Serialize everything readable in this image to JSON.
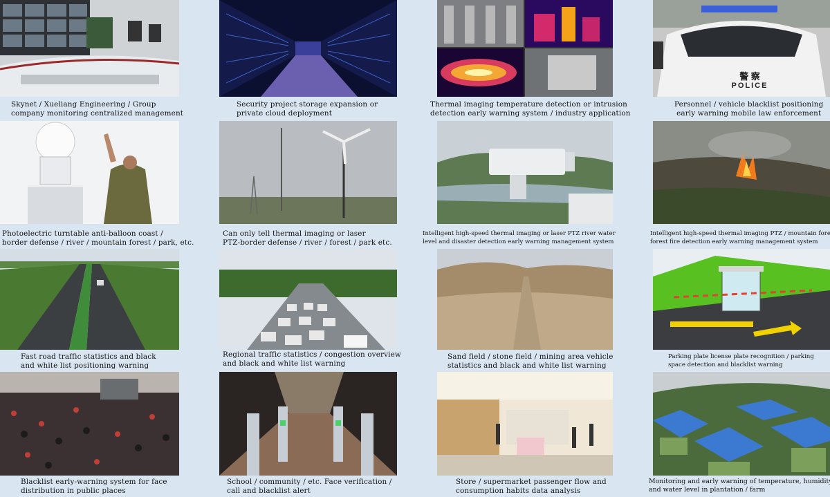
{
  "tiles": [
    {
      "name": "monitoring-center",
      "lines": [
        "Skynet / Xueliang Engineering / Group",
        "company monitoring centralized management"
      ]
    },
    {
      "name": "storage-datacenter",
      "lines": [
        "Security project storage expansion or",
        "private cloud deployment"
      ]
    },
    {
      "name": "thermal-imaging",
      "lines": [
        "Thermal imaging temperature detection or intrusion",
        "detection early warning system / industry application"
      ]
    },
    {
      "name": "police-vehicle",
      "lines": [
        "Personnel / vehicle blacklist positioning",
        "early warning mobile law enforcement"
      ],
      "badge": "POLICE",
      "badge_cn": "警 察"
    },
    {
      "name": "anti-balloon-turntable",
      "lines": [
        "Photoelectric turntable anti-balloon coast /",
        "border defense / river / mountain forest / park, etc."
      ]
    },
    {
      "name": "ptz-border-defense",
      "lines": [
        "Can only tell thermal imaging or laser",
        "PTZ-border defense / river / forest / park etc."
      ]
    },
    {
      "name": "river-water-level",
      "lines": [
        "Intelligent high-speed thermal imaging or laser PTZ river water",
        "level and disaster detection early warning management system"
      ]
    },
    {
      "name": "forest-fire",
      "lines": [
        "Intelligent high-speed thermal imaging PTZ / mountain forest /",
        "forest fire detection early warning management system"
      ]
    },
    {
      "name": "highway-traffic",
      "lines": [
        "Fast road traffic statistics and black",
        "and white list positioning warning"
      ]
    },
    {
      "name": "regional-traffic",
      "lines": [
        "Regional traffic statistics / congestion overview",
        "and black and white list warning"
      ]
    },
    {
      "name": "sand-field",
      "lines": [
        "Sand field / stone field / mining area vehicle",
        "statistics and black and white list warning"
      ]
    },
    {
      "name": "parking-plate",
      "lines": [
        "Parking plate license plate recognition / parking",
        "space detection and blacklist warning"
      ]
    },
    {
      "name": "crowd-face",
      "lines": [
        "Blacklist early-warning system for face",
        "distribution in public places"
      ]
    },
    {
      "name": "school-gate",
      "lines": [
        "School / community / etc. Face verification /",
        "call and blacklist alert"
      ]
    },
    {
      "name": "store-passenger",
      "lines": [
        "Store / supermarket passenger flow and",
        "consumption habits data analysis"
      ]
    },
    {
      "name": "plantation-farm",
      "lines": [
        "Monitoring and early warning of temperature, humidity",
        "and water level in plantation / farm"
      ]
    }
  ]
}
